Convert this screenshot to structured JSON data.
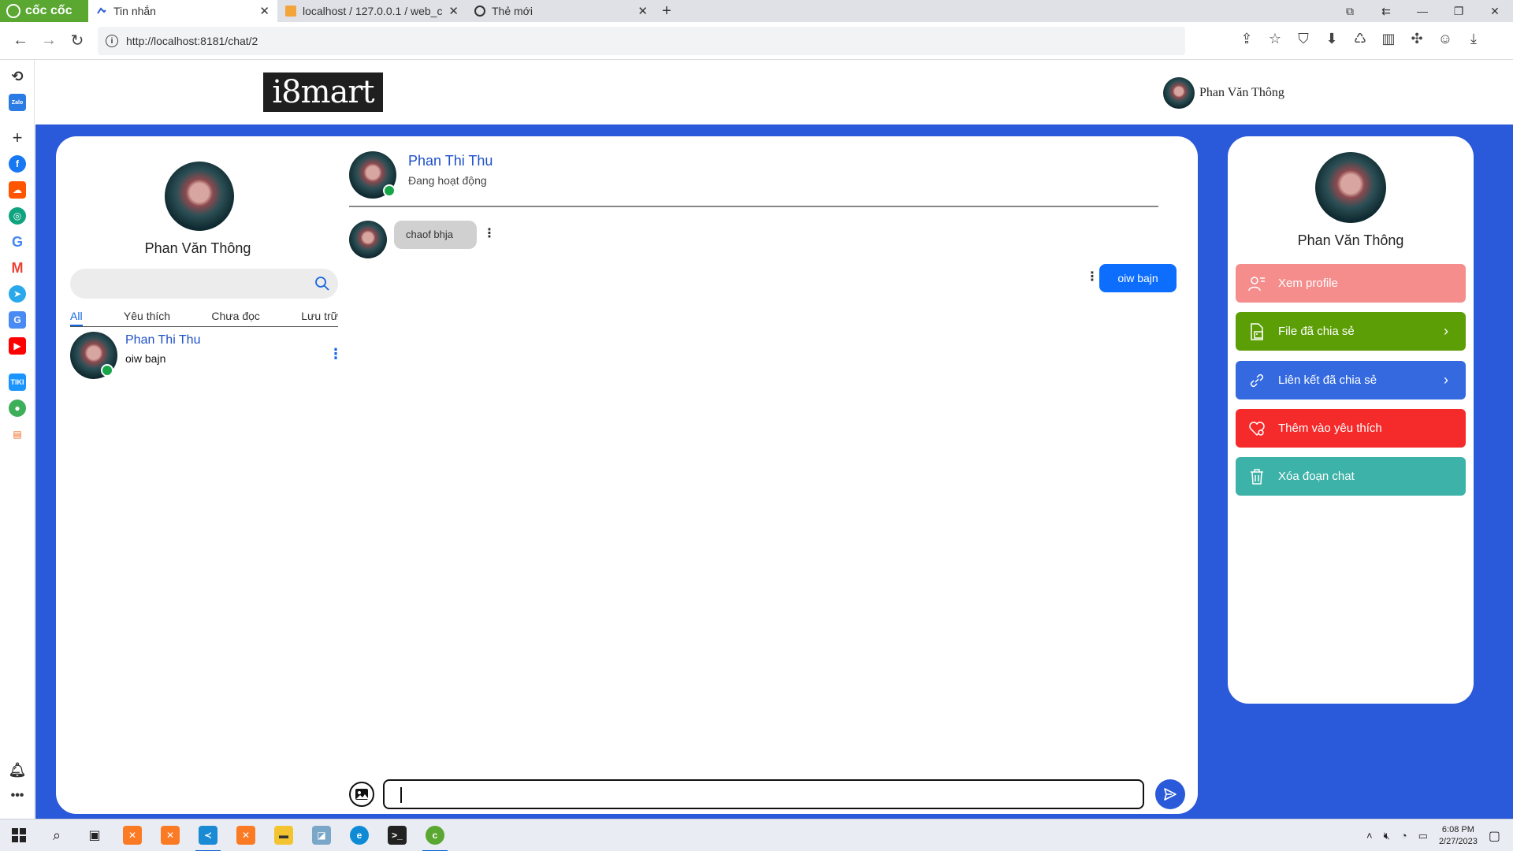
{
  "browser": {
    "brand": "cốc cốc",
    "tabs": [
      {
        "title": "Tin nhắn",
        "active": true
      },
      {
        "title": "localhost / 127.0.0.1 / web_c",
        "active": false
      },
      {
        "title": "Thẻ mới",
        "active": false
      }
    ],
    "url": "http://localhost:8181/chat/2"
  },
  "sidebar_icons": [
    "history-icon",
    "zalo-icon",
    "add-icon",
    "facebook-icon",
    "soundcloud-icon",
    "chatgpt-icon",
    "google-icon",
    "gmail-icon",
    "telegram-icon",
    "translate-icon",
    "youtube-icon",
    "tiki-icon",
    "game-icon",
    "shop-icon",
    "notification-icon",
    "more-icon"
  ],
  "header": {
    "logo_text": "i8mart",
    "user_name": "Phan Văn Thông"
  },
  "left_panel": {
    "me_name": "Phan Văn Thông",
    "search_placeholder": "",
    "filters": [
      "All",
      "Yêu thích",
      "Chưa đọc",
      "Lưu trữ"
    ],
    "conversations": [
      {
        "name": "Phan Thi Thu",
        "last_message": "oiw bajn",
        "online": true
      }
    ]
  },
  "chat": {
    "peer_name": "Phan Thi Thu",
    "peer_status": "Đang hoạt động",
    "messages": [
      {
        "direction": "in",
        "text": "chaof bhja"
      },
      {
        "direction": "out",
        "text": "oiw bajn"
      }
    ],
    "input_value": ""
  },
  "right_panel": {
    "name": "Phan Văn Thông",
    "actions": [
      {
        "label": "Xem profile",
        "color": "#f58d8d",
        "icon": "user-list-icon",
        "chevron": false
      },
      {
        "label": "File đã chia sẻ",
        "color": "#5c9e06",
        "icon": "file-image-icon",
        "chevron": true
      },
      {
        "label": "Liên kết đã chia sẻ",
        "color": "#3469e0",
        "icon": "link-icon",
        "chevron": true
      },
      {
        "label": "Thêm vào yêu thích",
        "color": "#f52a2a",
        "icon": "heart-icon",
        "chevron": false
      },
      {
        "label": "Xóa đoạn chat",
        "color": "#3cb2a8",
        "icon": "trash-icon",
        "chevron": false
      }
    ]
  },
  "taskbar": {
    "time": "6:08 PM",
    "date": "2/27/2023"
  },
  "colors": {
    "accent_blue": "#2a5ada",
    "bubble_out": "#0d6efd",
    "online": "#18a54a"
  }
}
